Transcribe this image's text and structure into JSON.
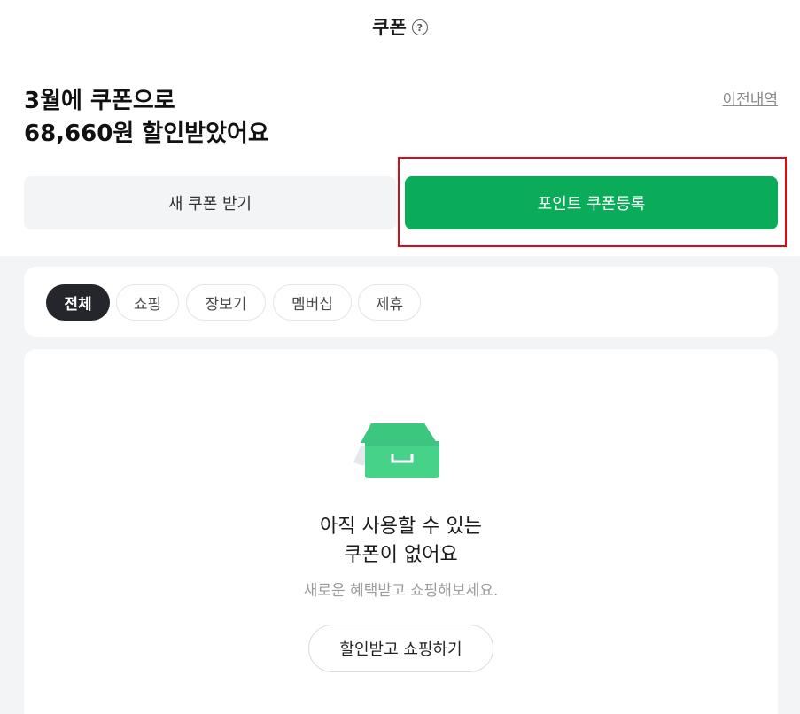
{
  "header": {
    "title": "쿠폰",
    "help_icon_glyph": "?"
  },
  "summary": {
    "line1": "3월에 쿠폰으로",
    "line2": "68,660원 할인받았어요"
  },
  "history_link": "이전내역",
  "buttons": {
    "new_coupon": "새 쿠폰 받기",
    "register": "포인트 쿠폰등록"
  },
  "filters": [
    {
      "label": "전체",
      "active": true
    },
    {
      "label": "쇼핑",
      "active": false
    },
    {
      "label": "장보기",
      "active": false
    },
    {
      "label": "멤버십",
      "active": false
    },
    {
      "label": "제휴",
      "active": false
    }
  ],
  "empty_state": {
    "title_line1": "아직 사용할 수 있는",
    "title_line2": "쿠폰이 없어요",
    "subtitle": "새로운 혜택받고 쇼핑해보세요.",
    "cta": "할인받고 쇼핑하기",
    "icon": "empty-tray-icon"
  },
  "colors": {
    "brand_green": "#0aac5a",
    "highlight_red": "#e30613",
    "active_chip": "#24262b"
  }
}
